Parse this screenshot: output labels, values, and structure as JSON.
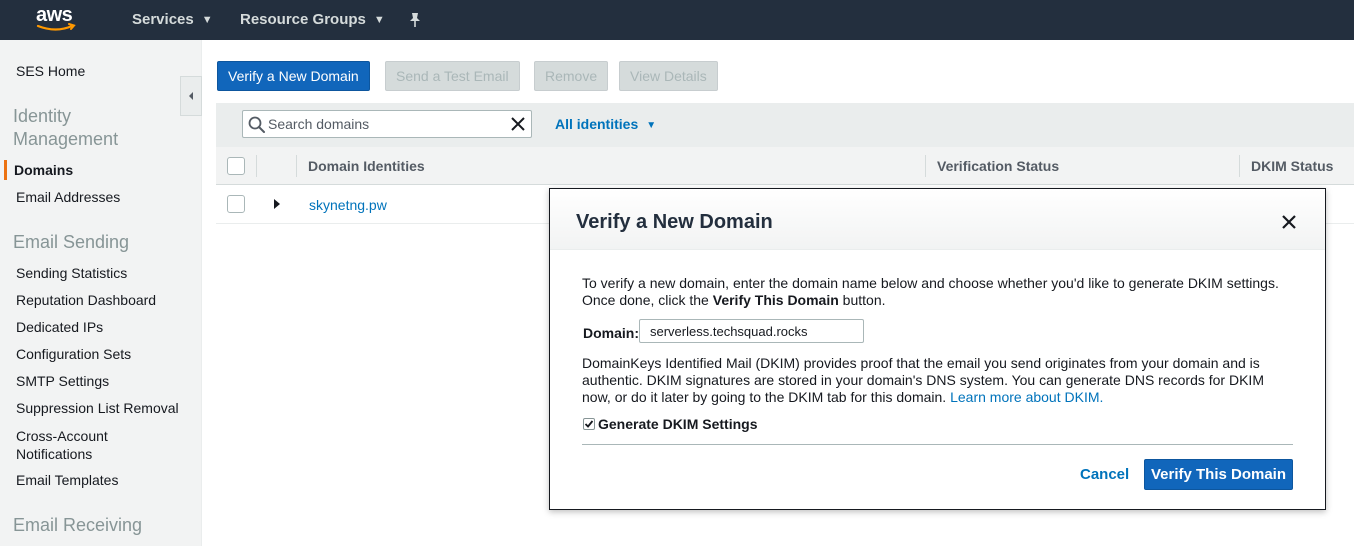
{
  "topnav": {
    "logo_text": "aws",
    "services_label": "Services",
    "resource_groups_label": "Resource Groups"
  },
  "sidebar": {
    "home": "SES Home",
    "identity_header": "Identity Management",
    "identity_items": [
      "Domains",
      "Email Addresses"
    ],
    "sending_header": "Email Sending",
    "sending_items": [
      "Sending Statistics",
      "Reputation Dashboard",
      "Dedicated IPs",
      "Configuration Sets",
      "SMTP Settings",
      "Suppression List Removal",
      "Cross-Account Notifications",
      "Email Templates"
    ],
    "receiving_header": "Email Receiving"
  },
  "toolbar": {
    "verify_domain": "Verify a New Domain",
    "send_test": "Send a Test Email",
    "remove": "Remove",
    "view_details": "View Details"
  },
  "filter": {
    "search_placeholder": "Search domains",
    "all_identities": "All identities"
  },
  "table": {
    "columns": [
      "Domain Identities",
      "Verification Status",
      "DKIM Status"
    ],
    "rows": [
      {
        "domain": "skynetng.pw"
      }
    ]
  },
  "modal": {
    "title": "Verify a New Domain",
    "intro_part1": "To verify a new domain, enter the domain name below and choose whether you'd like to generate DKIM settings. Once done, click the ",
    "intro_bold": "Verify This Domain",
    "intro_part2": " button.",
    "domain_label": "Domain:",
    "domain_value": "serverless.techsquad.rocks",
    "dkim_text": "DomainKeys Identified Mail (DKIM) provides proof that the email you send originates from your domain and is authentic. DKIM signatures are stored in your domain's DNS system. You can generate DNS records for DKIM now, or do it later by going to the DKIM tab for this domain. ",
    "learn_more": "Learn more about DKIM.",
    "generate_dkim_label": "Generate DKIM Settings",
    "generate_dkim_checked": true,
    "cancel": "Cancel",
    "verify_button": "Verify This Domain"
  },
  "colors": {
    "nav_bg": "#232f3e",
    "primary": "#1166bb",
    "link": "#0073bb",
    "active_accent": "#ec7211"
  }
}
